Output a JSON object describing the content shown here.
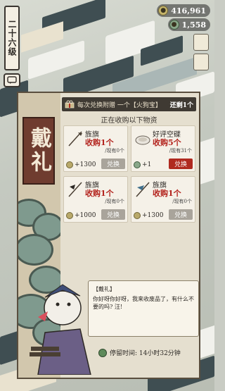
{
  "player": {
    "level_text": "二十六级"
  },
  "currency": {
    "silver": "416,961",
    "jade": "1,558"
  },
  "shop": {
    "title": "戴礼",
    "notice": "每次兑换附赠 一个【火狗宝】",
    "remaining": "还剩1个",
    "subtitle": "正在收购以下物资",
    "items": [
      {
        "name": "旌旗",
        "request": "收购1个",
        "have": "/现有0个",
        "reward_icon": "silver-coin-icon",
        "reward": "+1300",
        "button": "兑换",
        "button_state": "disabled"
      },
      {
        "name": "好评空碟",
        "request": "收购5个",
        "have": "/现有31个",
        "reward_icon": "jade-coin-icon",
        "reward": "+1",
        "button": "兑换",
        "button_state": "active"
      },
      {
        "name": "旌旗",
        "request": "收购1个",
        "have": "/现有0个",
        "reward_icon": "silver-coin-icon",
        "reward": "+1000",
        "button": "兑换",
        "button_state": "disabled"
      },
      {
        "name": "旌旗",
        "request": "收购1个",
        "have": "/现有0个",
        "reward_icon": "silver-coin-icon",
        "reward": "+1300",
        "button": "兑换",
        "button_state": "disabled"
      }
    ]
  },
  "dialog": {
    "speaker": "【戴礼】",
    "text": "你好呀你好呀，我来收废品了，有什么不要的吗? 汪!"
  },
  "timer": {
    "label": "停留时间: 14小时32分钟"
  },
  "colors": {
    "accent_red": "#b02a20",
    "panel_bg": "#e5dfcf",
    "title_bg": "#6f3c2f"
  }
}
